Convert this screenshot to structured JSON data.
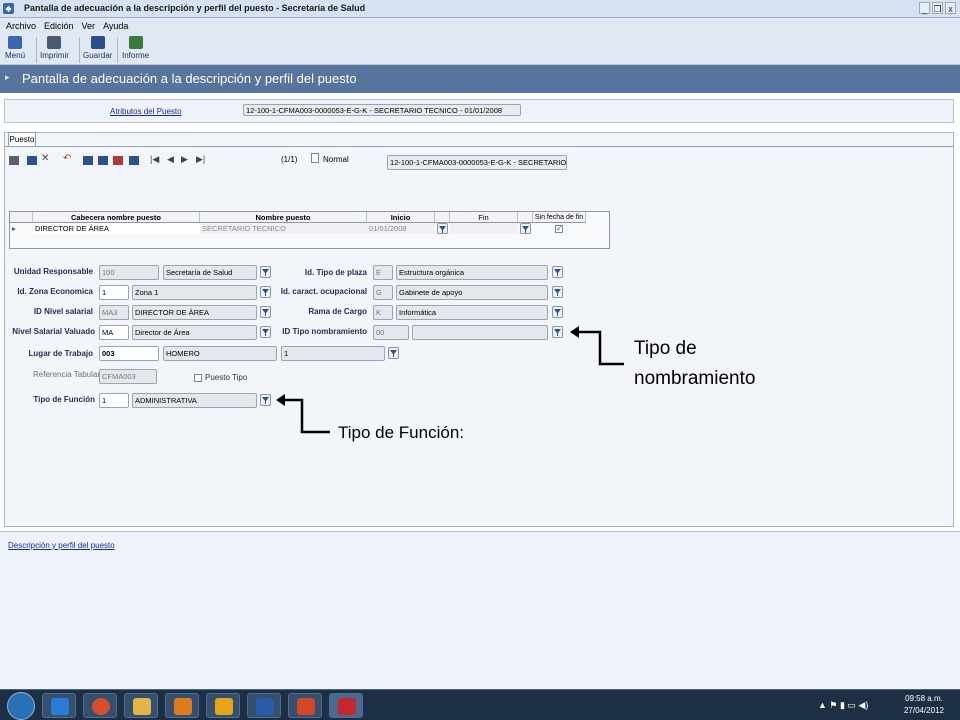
{
  "window": {
    "title": "Pantalla de adecuación a la descripción y perfil del puesto  - Secretaría de Salud",
    "controls": [
      "_",
      "❐",
      "x"
    ]
  },
  "menu": [
    "Archivo",
    "Edición",
    "Ver",
    "Ayuda"
  ],
  "toolbar": [
    {
      "label": "Menú",
      "icon": "menu-icon",
      "color": "#3a66b0"
    },
    {
      "label": "Imprimir",
      "icon": "printer-icon",
      "color": "#4a5a6e"
    },
    {
      "label": "Guardar",
      "icon": "save-icon",
      "color": "#2b4c8c"
    },
    {
      "label": "Informe",
      "icon": "report-icon",
      "color": "#3b7a3b"
    }
  ],
  "header": {
    "title": "Pantalla de adecuación a la descripción y perfil del puesto"
  },
  "attributes": {
    "link": "Atributos del Puesto",
    "value": "12-100-1-CFMA003-0000053-E-G-K - SECRETARIO TECNICO - 01/01/2008"
  },
  "tab": "Puesto",
  "record": {
    "counter": "(1/1)",
    "mode": "Normal",
    "key": "12-100-1-CFMA003-0000053-E-G-K - SECRETARIO TEC"
  },
  "grid": {
    "headers": [
      "Cabecera nombre puesto",
      "Nombre puesto",
      "Inicio",
      "Fin",
      "Sin fecha de fin"
    ],
    "row": {
      "cabecera": "DIRECTOR DE ÁREA",
      "nombre": "SECRETARIO TECNICO",
      "inicio": "01/01/2008",
      "fin": "",
      "sin_fecha": true
    }
  },
  "form": {
    "unidad_responsable": {
      "label": "Unidad Responsable",
      "code": "100",
      "desc": "Secretaría de Salud"
    },
    "id_zona": {
      "label": "Id. Zona Economica",
      "code": "1",
      "desc": "Zona 1"
    },
    "id_nivel": {
      "label": "ID Nivel salarial",
      "code": "MA3",
      "desc": "DIRECTOR DE ÁREA"
    },
    "nivel_valuado": {
      "label": "Nivel Salarial Valuado",
      "code": "MA",
      "desc": "Director de Área"
    },
    "lugar": {
      "label": "Lugar de Trabajo",
      "code": "003",
      "desc": "HOMERO",
      "extra": "1"
    },
    "referencia": {
      "label": "Referencia Tabular",
      "code": "CFMA003"
    },
    "puesto_tipo": {
      "label": "Puesto Tipo",
      "checked": false
    },
    "tipo_funcion": {
      "label": "Tipo de Función",
      "code": "1",
      "desc": "ADMINISTRATIVA"
    },
    "tipo_plaza": {
      "label": "Id. Tipo de plaza",
      "code": "E",
      "desc": "Estructura orgánica"
    },
    "caract": {
      "label": "Id. caract. ocupacional",
      "code": "G",
      "desc": "Gabinete de apoyo"
    },
    "rama": {
      "label": "Rama de Cargo",
      "code": "K",
      "desc": "Informática"
    },
    "nombramiento": {
      "label": "ID Tipo nombramiento",
      "code": "00",
      "desc": ""
    }
  },
  "bottom": {
    "link": "Descripción y perfil del puesto"
  },
  "annotations": {
    "nombramiento_line1": "Tipo de",
    "nombramiento_line2": "nombramiento",
    "funcion": "Tipo de Función:"
  },
  "taskbar": {
    "time": "09:58 a.m.",
    "date": "27/04/2012"
  }
}
